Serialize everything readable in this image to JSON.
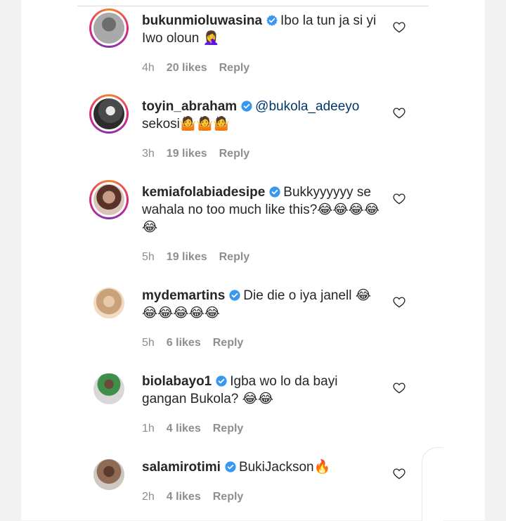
{
  "comments": [
    {
      "username": "bukunmioluwasina",
      "mention": "",
      "text": "Ibo la tun ja si yi Iwo oloun 🤦‍♀️",
      "time": "4h",
      "likes": "20 likes",
      "reply": "Reply",
      "story_ring": true
    },
    {
      "username": "toyin_abraham",
      "mention": "@bukola_adeeyo",
      "text": "sekosi🤷🤷🤷",
      "time": "3h",
      "likes": "19 likes",
      "reply": "Reply",
      "story_ring": true
    },
    {
      "username": "kemiafolabiadesipe",
      "mention": "",
      "text": "Bukkyyyyyy se wahala no too much like this?😂😂😂😂😂",
      "time": "5h",
      "likes": "19 likes",
      "reply": "Reply",
      "story_ring": true
    },
    {
      "username": "mydemartins",
      "mention": "",
      "text": "Die die o iya janell 😂😂😂😂😂😂",
      "time": "5h",
      "likes": "6 likes",
      "reply": "Reply",
      "story_ring": false
    },
    {
      "username": "biolabayo1",
      "mention": "",
      "text": "Igba wo lo da bayi gangan Bukola? 😂😂",
      "time": "1h",
      "likes": "4 likes",
      "reply": "Reply",
      "story_ring": false
    },
    {
      "username": "salamirotimi",
      "mention": "",
      "text": "BukiJackson🔥",
      "time": "2h",
      "likes": "4 likes",
      "reply": "Reply",
      "story_ring": false
    }
  ],
  "colors": {
    "verified": "#3897f0",
    "mention": "#00376b",
    "muted": "#8e8e8e"
  },
  "icons": {
    "verified": "verified-badge-icon",
    "like": "heart-icon"
  }
}
